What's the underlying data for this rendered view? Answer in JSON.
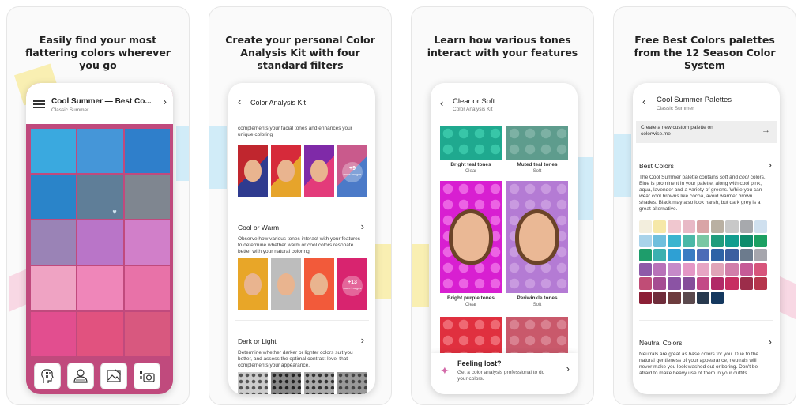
{
  "cards": [
    {
      "headline": "Easily find your most flattering colors wherever you go",
      "screen": {
        "title": "Cool Summer — Best Co...",
        "subtitle": "Classic Summer",
        "swatches": [
          "#3aa9df",
          "#4596d8",
          "#2f7fcb",
          "#2a84c9",
          "#5f7e98",
          "#7f8690",
          "#9a83b6",
          "#b975c8",
          "#d17fc9",
          "#efa3c3",
          "#ef86b9",
          "#e872a8",
          "#e24e8f",
          "#e1527f",
          "#d8587f"
        ],
        "tab_icons": [
          "palette-face-icon",
          "person-icon",
          "image-icon",
          "camera-icon"
        ]
      }
    },
    {
      "headline": "Create your personal Color Analysis Kit with four standard filters",
      "screen": {
        "title": "Color Analysis Kit",
        "intro": "complements your facial tones and enhances your unique coloring",
        "row1_more": "+9",
        "row1_more_sub": "more images",
        "sec1_title": "Cool or Warm",
        "sec1_desc": "Observe how various tones interact with your features to determine whether warm or cool colors resonate better with your natural coloring.",
        "row2_more": "+13",
        "row2_more_sub": "more images",
        "sec2_title": "Dark or Light",
        "sec2_desc": "Determine whether darker or lighter colors suit you better, and assess the optimal contrast level that complements your appearance."
      }
    },
    {
      "headline": "Learn how various tones interact with your features",
      "screen": {
        "title": "Clear or Soft",
        "subtitle": "Color Analysis Kit",
        "tiles": [
          {
            "name": "Bright teal tones",
            "sub": "Clear",
            "color": "#1fa98f",
            "dot": "#38c6a8"
          },
          {
            "name": "Muted teal tones",
            "sub": "Soft",
            "color": "#5e9c8d",
            "dot": "#7db1a4"
          },
          {
            "name": "Bright purple tones",
            "sub": "Clear",
            "color": "#d81fd1",
            "dot": "#ec63e4"
          },
          {
            "name": "Periwinkle tones",
            "sub": "Soft",
            "color": "#b47bd4",
            "dot": "#c99ae0"
          },
          {
            "name": "",
            "sub": "",
            "color": "#e0303f",
            "dot": "#ef6973"
          },
          {
            "name": "",
            "sub": "",
            "color": "#c9596b",
            "dot": "#d98190"
          }
        ],
        "lost_title": "Feeling lost?",
        "lost_desc": "Get a color analysis professional to do your colors."
      }
    },
    {
      "headline": "Free Best Colors palettes from the 12 Season Color System",
      "screen": {
        "title": "Cool Summer Palettes",
        "subtitle": "Classic Summer",
        "create_label": "Create a new custom palette on colorwise.me",
        "best_title": "Best Colors",
        "best_desc_a": "The Cool Summer palette contains ",
        "best_desc_em1": "soft",
        "best_desc_b": " and ",
        "best_desc_em2": "cool",
        "best_desc_c": " colors. Blue is prominent in your palette, along with cool pink, aqua, lavender and a variety of greens. While you can wear cool browns like cocoa, avoid warmer brown shades. Black may also look harsh, but dark grey is a great alternative.",
        "palette": [
          "#f3eedd",
          "#f6e8a8",
          "#f0c7cf",
          "#e8b9c6",
          "#d9a4a6",
          "#b9b0a2",
          "#c8c8c8",
          "#a7a9ad",
          "#cfe0ef",
          "#a9d3ea",
          "#6fbfdd",
          "#3bb4cf",
          "#4ab8a7",
          "#79c7a4",
          "#1f9c7d",
          "#119d8f",
          "#0e8c6c",
          "#1ba062",
          "#1e9d6b",
          "#3bb0b0",
          "#2ea0d4",
          "#3a7cc3",
          "#4d6cb7",
          "#2e63a6",
          "#3b5fa0",
          "#6c7b8d",
          "#a6a6ad",
          "#8e5aa8",
          "#b872b9",
          "#c58ac9",
          "#e497c6",
          "#e7a5c4",
          "#e0a4b8",
          "#d17eaa",
          "#c65a96",
          "#d7547b",
          "#c04d76",
          "#a54c92",
          "#8b53a4",
          "#864e9a",
          "#c34a87",
          "#b12a67",
          "#c72e62",
          "#9c2d4a",
          "#b6354c",
          "#8b1f36",
          "#6f2d3b",
          "#6d3c3e",
          "#5b4a4e",
          "#27394e",
          "#14385f"
        ],
        "neutral_title": "Neutral Colors",
        "neutral_desc_a": "Neutrals are great as ",
        "neutral_desc_em": "base",
        "neutral_desc_b": " colors for you. Due to the natural gentleness of your appearance, neutrals will never make you look washed out or boring. Don't be afraid to make heavy use of them in your outfits."
      }
    }
  ]
}
